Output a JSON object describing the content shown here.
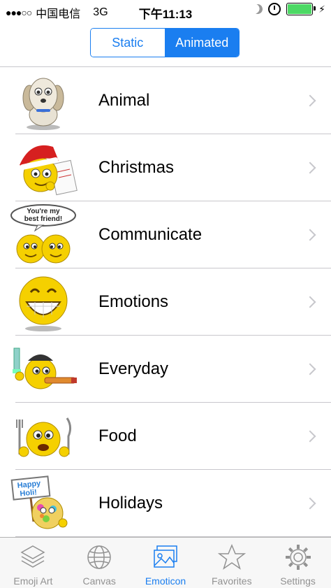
{
  "status_bar": {
    "signal": "●●●○○",
    "carrier": "中国电信",
    "network": "3G",
    "time": "下午11:13"
  },
  "segmented": {
    "options": [
      "Static",
      "Animated"
    ],
    "selected": "Animated"
  },
  "categories": [
    {
      "label": "Animal",
      "icon": "dog-icon"
    },
    {
      "label": "Christmas",
      "icon": "santa-smiley-icon"
    },
    {
      "label": "Communicate",
      "icon": "best-friends-smiley-icon",
      "bubble_text": "You're my best friend!"
    },
    {
      "label": "Emotions",
      "icon": "grinning-smiley-icon"
    },
    {
      "label": "Everyday",
      "icon": "party-smiley-icon"
    },
    {
      "label": "Food",
      "icon": "hungry-smiley-icon"
    },
    {
      "label": "Holidays",
      "icon": "holi-smiley-icon",
      "sign_text": "Happy Holi!"
    }
  ],
  "tabs": [
    {
      "label": "Emoji Art",
      "icon": "layers-icon"
    },
    {
      "label": "Canvas",
      "icon": "globe-icon"
    },
    {
      "label": "Emoticon",
      "icon": "picture-icon",
      "active": true
    },
    {
      "label": "Favorites",
      "icon": "star-icon"
    },
    {
      "label": "Settings",
      "icon": "gear-icon"
    }
  ],
  "colors": {
    "accent": "#1a7ef0",
    "smiley_yellow": "#f5d000",
    "chevron": "#c7c7cc",
    "battery": "#4cd964"
  }
}
